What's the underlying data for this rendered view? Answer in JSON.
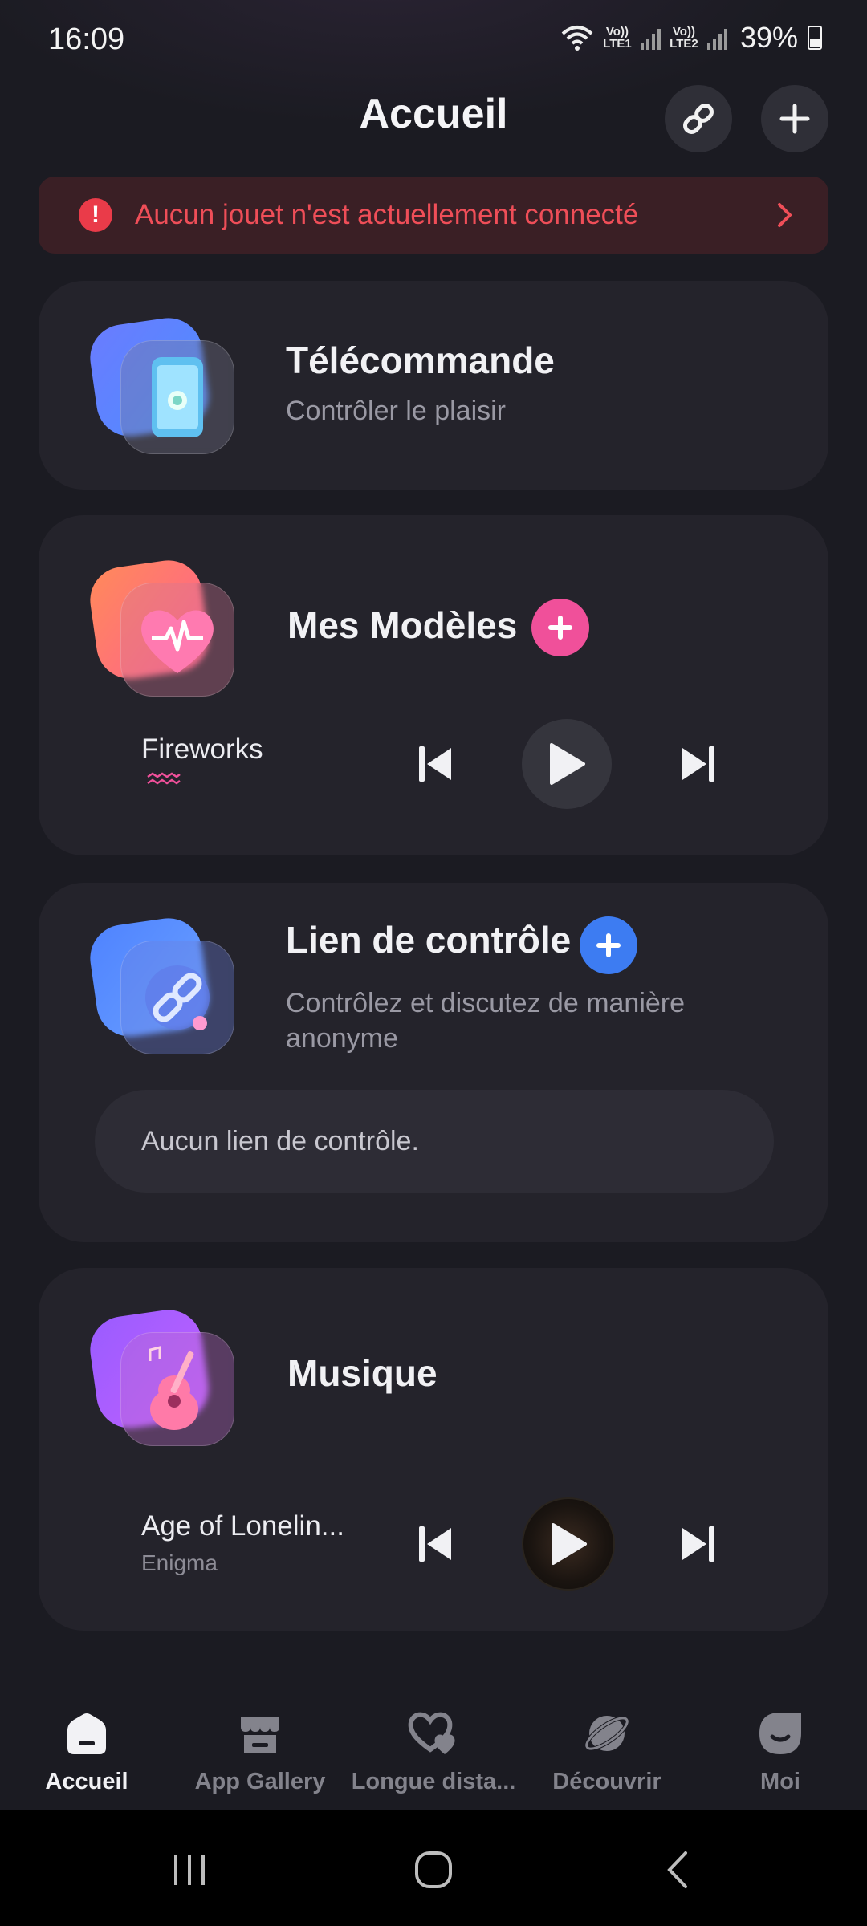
{
  "status_bar": {
    "time": "16:09",
    "sim1": "Vo)) LTE1",
    "sim2": "Vo)) LTE2",
    "battery": "39%"
  },
  "header": {
    "title": "Accueil"
  },
  "alert": {
    "text": "Aucun jouet n'est actuellement connecté",
    "color": "#ef4e58"
  },
  "remote": {
    "title": "Télécommande",
    "subtitle": "Contrôler le plaisir",
    "icon": "phone-remote-icon"
  },
  "patterns": {
    "title": "Mes Modèles",
    "icon": "heart-pulse-icon",
    "track": "Fireworks",
    "accent": "#f0509a"
  },
  "control_link": {
    "title": "Lien de contrôle",
    "subtitle": "Contrôlez et discutez de manière anonyme",
    "empty": "Aucun lien de contrôle.",
    "icon": "chain-link-icon",
    "accent": "#3d7cf2"
  },
  "music": {
    "title": "Musique",
    "icon": "guitar-icon",
    "track": "Age of Lonelin...",
    "artist": "Enigma"
  },
  "bottom_nav": {
    "items": [
      {
        "label": "Accueil",
        "icon": "home-icon",
        "active": true
      },
      {
        "label": "App Gallery",
        "icon": "store-icon",
        "active": false
      },
      {
        "label": "Longue dista...",
        "icon": "hearts-icon",
        "active": false
      },
      {
        "label": "Découvrir",
        "icon": "planet-icon",
        "active": false
      },
      {
        "label": "Moi",
        "icon": "face-icon",
        "active": false
      }
    ]
  }
}
